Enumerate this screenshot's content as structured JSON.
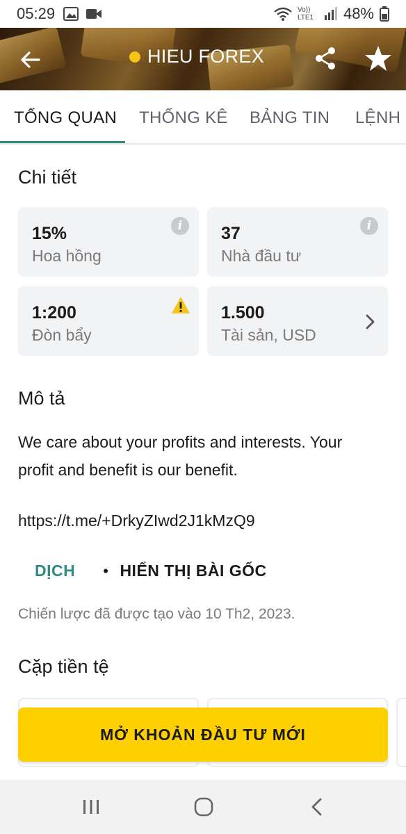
{
  "status_bar": {
    "time": "05:29",
    "signal_label": "Vo)) LTE1",
    "battery": "48%"
  },
  "header": {
    "title": "HIEU FOREX",
    "status_dot_color": "#f5c518",
    "icons": [
      "back-arrow-icon",
      "share-icon",
      "star-icon"
    ]
  },
  "tabs": [
    {
      "label": "TỔNG QUAN",
      "active": true
    },
    {
      "label": "THỐNG KÊ",
      "active": false
    },
    {
      "label": "BẢNG TIN",
      "active": false
    },
    {
      "label": "LỆNH G",
      "active": false
    }
  ],
  "details": {
    "title": "Chi tiết",
    "cards": [
      {
        "value": "15%",
        "label": "Hoa hồng",
        "icon": "info-icon"
      },
      {
        "value": "37",
        "label": "Nhà đầu tư",
        "icon": "info-icon"
      },
      {
        "value": "1:200",
        "label": "Đòn bẩy",
        "icon": "warning-icon"
      },
      {
        "value": "1.500",
        "label": "Tài sản, USD",
        "icon": "chevron-right-icon"
      }
    ]
  },
  "description": {
    "title": "Mô tả",
    "text": "We care about your profits and interests. Your profit and benefit is our benefit.",
    "link": "https://t.me/+DrkyZIwd2J1kMzQ9",
    "translate_label": "DỊCH",
    "show_original_label": "HIỂN THỊ BÀI GỐC",
    "created": "Chiến lược đã được tạo vào 10 Th2, 2023."
  },
  "currency_pairs": {
    "title": "Cặp tiền tệ"
  },
  "cta": {
    "label": "MỞ KHOẢN ĐẦU TƯ MỚI",
    "color": "#ffd000"
  },
  "colors": {
    "accent": "#2e8c82",
    "card_bg": "#f2f3f5",
    "warning": "#f5c518"
  }
}
